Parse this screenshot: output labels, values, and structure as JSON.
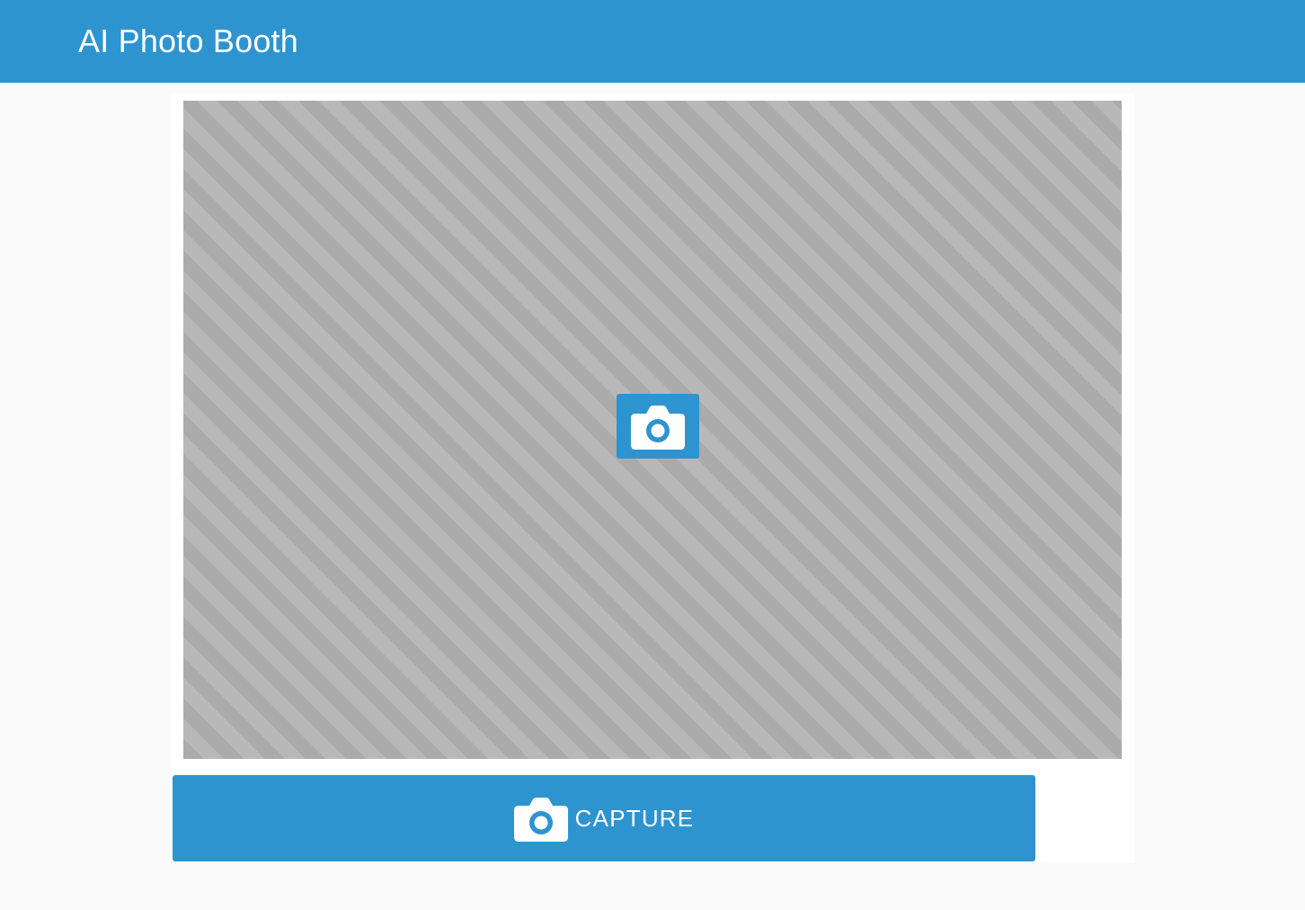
{
  "header": {
    "title": "AI Photo Booth"
  },
  "viewfinder": {
    "icon": "camera-icon"
  },
  "capture": {
    "label": "CAPTURE",
    "icon": "camera-icon"
  },
  "colors": {
    "primary": "#2d94d0",
    "background": "#fafafa",
    "panel": "#ffffff",
    "stripe_dark": "#ababab",
    "stripe_light": "#b8b8b8"
  }
}
